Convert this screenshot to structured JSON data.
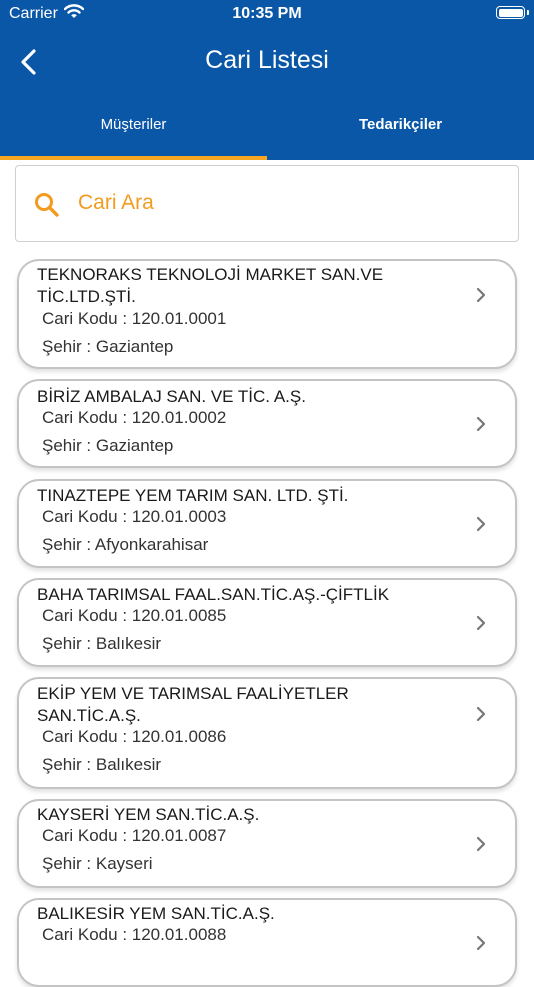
{
  "status_bar": {
    "carrier": "Carrier",
    "time": "10:35 PM"
  },
  "nav": {
    "title": "Cari Listesi"
  },
  "tabs": [
    {
      "label": "Müşteriler"
    },
    {
      "label": "Tedarikçiler"
    }
  ],
  "search": {
    "placeholder": "Cari Ara"
  },
  "customers": [
    {
      "name": "TEKNORAKS TEKNOLOJİ MARKET SAN.VE TİC.LTD.ŞTİ.",
      "code": "Cari Kodu : 120.01.0001",
      "city": "Şehir : Gaziantep"
    },
    {
      "name": "BİRİZ AMBALAJ SAN. VE TİC. A.Ş.",
      "code": "Cari Kodu : 120.01.0002",
      "city": "Şehir : Gaziantep"
    },
    {
      "name": "TINAZTEPE YEM TARIM SAN. LTD. ŞTİ.",
      "code": "Cari Kodu : 120.01.0003",
      "city": "Şehir : Afyonkarahisar"
    },
    {
      "name": "BAHA TARIMSAL FAAL.SAN.TİC.AŞ.-ÇİFTLİK",
      "code": "Cari Kodu : 120.01.0085",
      "city": "Şehir : Balıkesir"
    },
    {
      "name": "EKİP YEM VE TARIMSAL FAALİYETLER SAN.TİC.A.Ş.",
      "code": "Cari Kodu : 120.01.0086",
      "city": "Şehir : Balıkesir"
    },
    {
      "name": "KAYSERİ YEM SAN.TİC.A.Ş.",
      "code": "Cari Kodu : 120.01.0087",
      "city": "Şehir : Kayseri"
    },
    {
      "name": "BALIKESİR YEM SAN.TİC.A.Ş.",
      "code": "Cari Kodu : 120.01.0088",
      "city": ""
    }
  ]
}
